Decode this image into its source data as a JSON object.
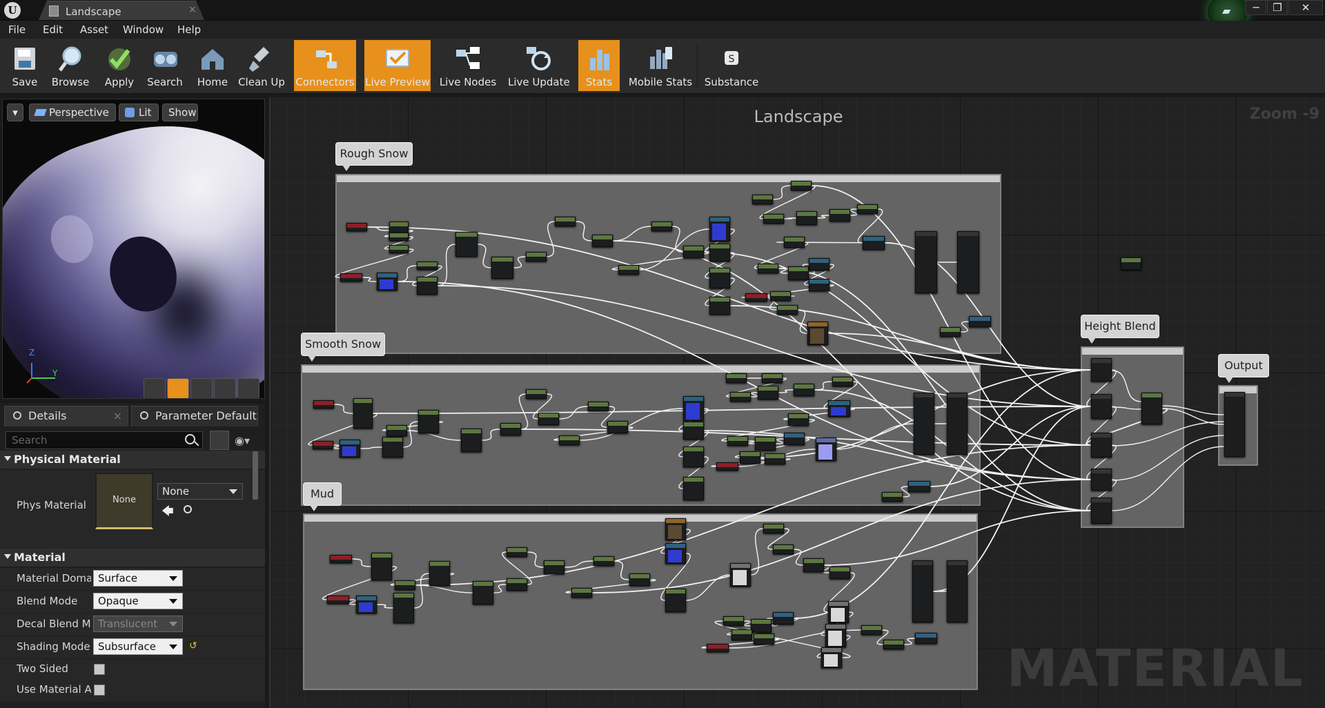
{
  "window": {
    "tab_title": "Landscape",
    "tab_close": "×"
  },
  "menu": [
    "File",
    "Edit",
    "Asset",
    "Window",
    "Help"
  ],
  "toolbar": [
    {
      "label": "Save",
      "icon": "save-icon",
      "active": false
    },
    {
      "label": "Browse",
      "icon": "browse-icon",
      "active": false
    },
    {
      "label": "Apply",
      "icon": "apply-icon",
      "active": false
    },
    {
      "label": "Search",
      "icon": "search-icon",
      "active": false
    },
    {
      "label": "Home",
      "icon": "home-icon",
      "active": false
    },
    {
      "label": "Clean Up",
      "icon": "clean-up-icon",
      "active": false
    },
    {
      "label": "Connectors",
      "icon": "connectors-icon",
      "active": true
    },
    {
      "label": "Live Preview",
      "icon": "live-preview-icon",
      "active": true
    },
    {
      "label": "Live Nodes",
      "icon": "live-nodes-icon",
      "active": false
    },
    {
      "label": "Live Update",
      "icon": "live-update-icon",
      "active": false
    },
    {
      "label": "Stats",
      "icon": "stats-icon",
      "active": true
    },
    {
      "label": "Mobile Stats",
      "icon": "mobile-stats-icon",
      "active": false
    },
    {
      "label": "Substance",
      "icon": "substance-icon",
      "active": false
    }
  ],
  "viewport": {
    "perspective": "Perspective",
    "lit": "Lit",
    "show": "Show",
    "axis_z": "Z",
    "axis_y": "Y"
  },
  "details": {
    "tab_details": "Details",
    "tab_params": "Parameter Default",
    "search_placeholder": "Search",
    "physical_material": "Physical Material",
    "phys_material_label": "Phys Material",
    "phys_thumb": "None",
    "phys_value": "None",
    "material_section": "Material",
    "material_domain_label": "Material Domai",
    "material_domain": "Surface",
    "blend_mode_label": "Blend Mode",
    "blend_mode": "Opaque",
    "decal_blend_label": "Decal Blend Mo",
    "decal_blend": "Translucent",
    "shading_model_label": "Shading Model",
    "shading_model": "Subsurface",
    "two_sided_label": "Two Sided",
    "use_material_label": "Use Material Att"
  },
  "graph": {
    "title": "Landscape",
    "zoom": "Zoom -9",
    "watermark": "MATERIAL",
    "comments": {
      "rough_snow": "Rough Snow",
      "smooth_snow": "Smooth Snow",
      "mud": "Mud",
      "height_blend": "Height Blend",
      "output": "Output"
    }
  },
  "colors": {
    "accent": "#e7901b",
    "node_green": "#566b3c",
    "node_blue": "#315d7a",
    "node_red": "#8a1d22"
  }
}
